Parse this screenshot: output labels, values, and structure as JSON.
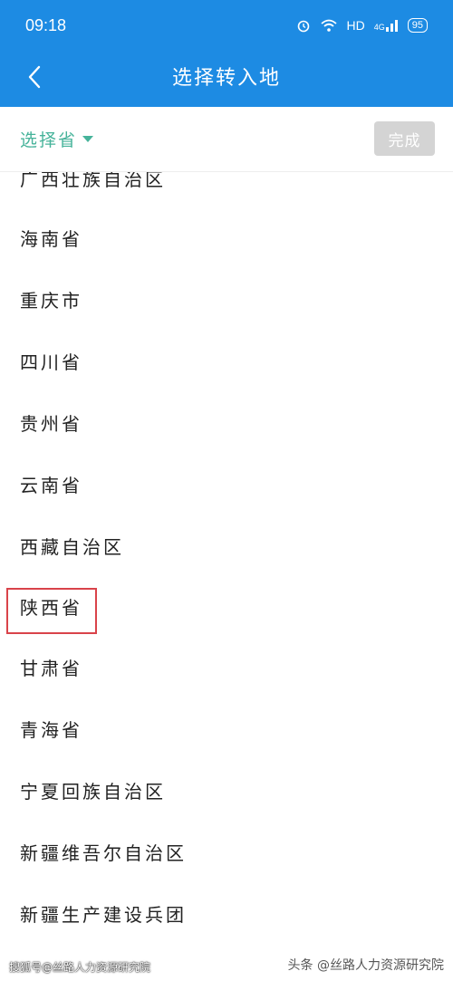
{
  "status_bar": {
    "time": "09:18",
    "network": "HD",
    "signal": "4G",
    "battery": "95"
  },
  "app_bar": {
    "back_icon": "chevron-left-icon",
    "title": "选择转入地"
  },
  "filter": {
    "select_label": "选择省",
    "done_label": "完成"
  },
  "provinces": [
    "广西壮族自治区",
    "海南省",
    "重庆市",
    "四川省",
    "贵州省",
    "云南省",
    "西藏自治区",
    "陕西省",
    "甘肃省",
    "青海省",
    "宁夏回族自治区",
    "新疆维吾尔自治区",
    "新疆生产建设兵团"
  ],
  "highlighted": "陕西省",
  "colors": {
    "primary": "#1d8be3",
    "accent": "#46b39a",
    "highlight": "#d9434a",
    "disabled": "#d4d4d4"
  },
  "watermarks": {
    "left": "搜狐号@丝路人力资源研究院",
    "right": "头条 @丝路人力资源研究院"
  }
}
